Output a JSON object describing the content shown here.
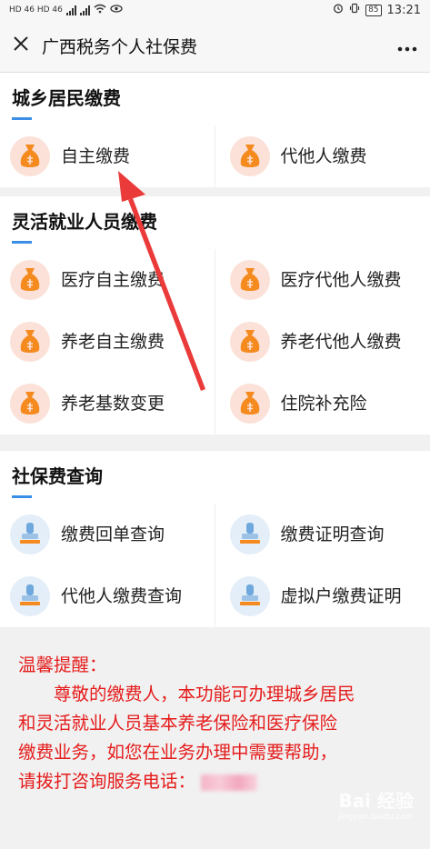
{
  "status": {
    "left_text": "HD 46 HD 46",
    "battery": "85",
    "time": "13:21"
  },
  "nav": {
    "close_icon": "close-icon",
    "title": "广西税务个人社保费",
    "more_icon": "more-icon"
  },
  "sections": [
    {
      "title": "城乡居民缴费",
      "items": [
        {
          "label": "自主缴费",
          "icon": "money-bag-icon"
        },
        {
          "label": "代他人缴费",
          "icon": "money-bag-icon"
        }
      ]
    },
    {
      "title": "灵活就业人员缴费",
      "items": [
        {
          "label": "医疗自主缴费",
          "icon": "money-bag-icon"
        },
        {
          "label": "医疗代他人缴费",
          "icon": "money-bag-icon"
        },
        {
          "label": "养老自主缴费",
          "icon": "money-bag-icon"
        },
        {
          "label": "养老代他人缴费",
          "icon": "money-bag-icon"
        },
        {
          "label": "养老基数变更",
          "icon": "money-bag-icon"
        },
        {
          "label": "住院补充险",
          "icon": "money-bag-icon"
        }
      ]
    },
    {
      "title": "社保费查询",
      "items": [
        {
          "label": "缴费回单查询",
          "icon": "stamp-icon"
        },
        {
          "label": "缴费证明查询",
          "icon": "stamp-icon"
        },
        {
          "label": "代他人缴费查询",
          "icon": "stamp-icon"
        },
        {
          "label": "虚拟户缴费证明",
          "icon": "stamp-icon"
        }
      ]
    }
  ],
  "notice": {
    "heading": "温馨提醒：",
    "line1": "尊敬的缴费人，本功能可办理城乡居民",
    "line2": "和灵活就业人员基本养老保险和医疗保险",
    "line3": "缴费业务，如您在业务办理中需要帮助，",
    "line4": "请拨打咨询服务电话：",
    "phone": "12366"
  },
  "watermark": {
    "text": "Bai 经验",
    "sub": "jingyan.baidu.com"
  },
  "colors": {
    "accent": "#3a8ee6",
    "notice": "#e51c1c",
    "bag_orange": "#f58a1f",
    "bag_bg": "#fbe1d7",
    "arrow": "#ea3a3a"
  }
}
